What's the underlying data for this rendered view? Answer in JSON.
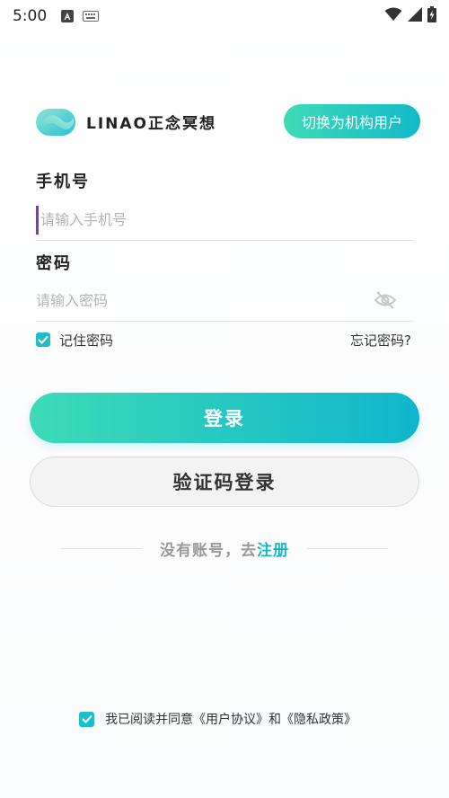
{
  "status_bar": {
    "time": "5:00",
    "icons": [
      "font-icon",
      "keyboard-icon",
      "wifi-icon",
      "signal-icon",
      "battery-charging-icon"
    ]
  },
  "brand": {
    "name": "LINAO正念冥想",
    "switch_label": "切换为机构用户",
    "accent_start": "#3ddbb6",
    "accent_end": "#12b9c9"
  },
  "phone": {
    "label": "手机号",
    "placeholder": "请输入手机号"
  },
  "password": {
    "label": "密码",
    "placeholder": "请输入密码",
    "icon": "eye-off-icon"
  },
  "remember": {
    "label": "记住密码",
    "checked": true
  },
  "forgot_label": "忘记密码?",
  "login_label": "登录",
  "code_login_label": "验证码登录",
  "register": {
    "prefix": "没有账号，去",
    "link": "注册"
  },
  "agreement": {
    "prefix": "我已阅读并同意",
    "user_agreement": "《用户协议》",
    "and": "和",
    "privacy_policy": "《隐私政策》",
    "checked": true
  }
}
